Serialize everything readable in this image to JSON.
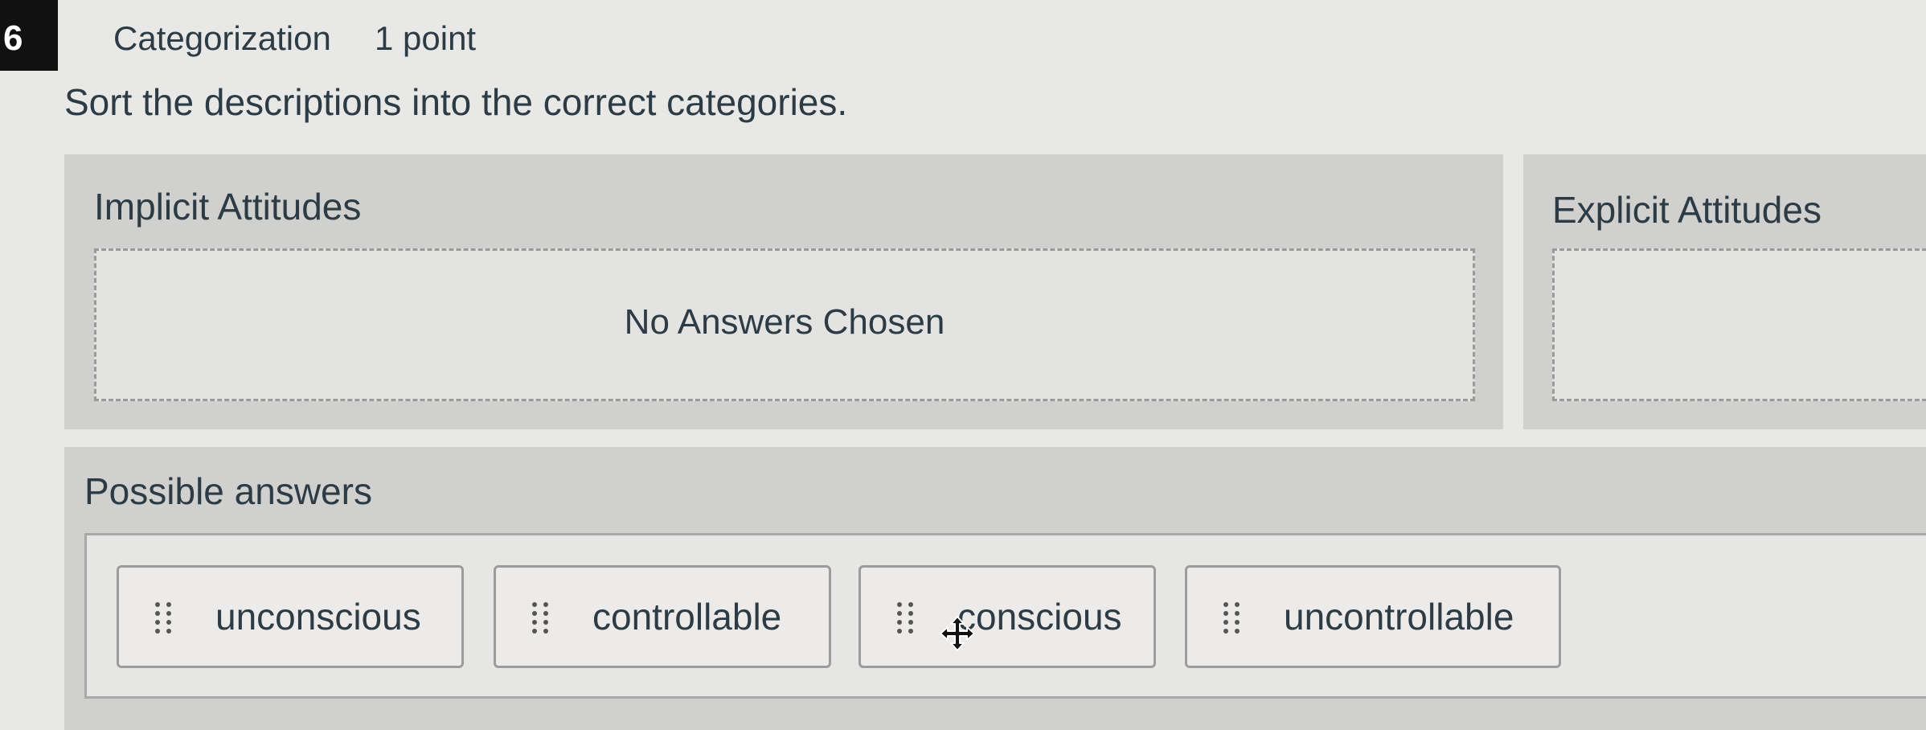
{
  "question": {
    "number": "6",
    "type": "Categorization",
    "points": "1 point",
    "prompt": "Sort the descriptions into the correct categories."
  },
  "categories": [
    {
      "title": "Implicit Attitudes",
      "empty_message": "No Answers Chosen"
    },
    {
      "title": "Explicit Attitudes",
      "empty_message": ""
    }
  ],
  "possible_answers": {
    "title": "Possible answers",
    "items": [
      {
        "label": "unconscious",
        "icon": "drag-handle-icon"
      },
      {
        "label": "controllable",
        "icon": "drag-handle-icon"
      },
      {
        "label": "conscious",
        "icon": "drag-handle-icon"
      },
      {
        "label": "uncontrollable",
        "icon": "drag-handle-icon"
      }
    ]
  },
  "cursor": {
    "icon": "move-cursor-icon"
  }
}
